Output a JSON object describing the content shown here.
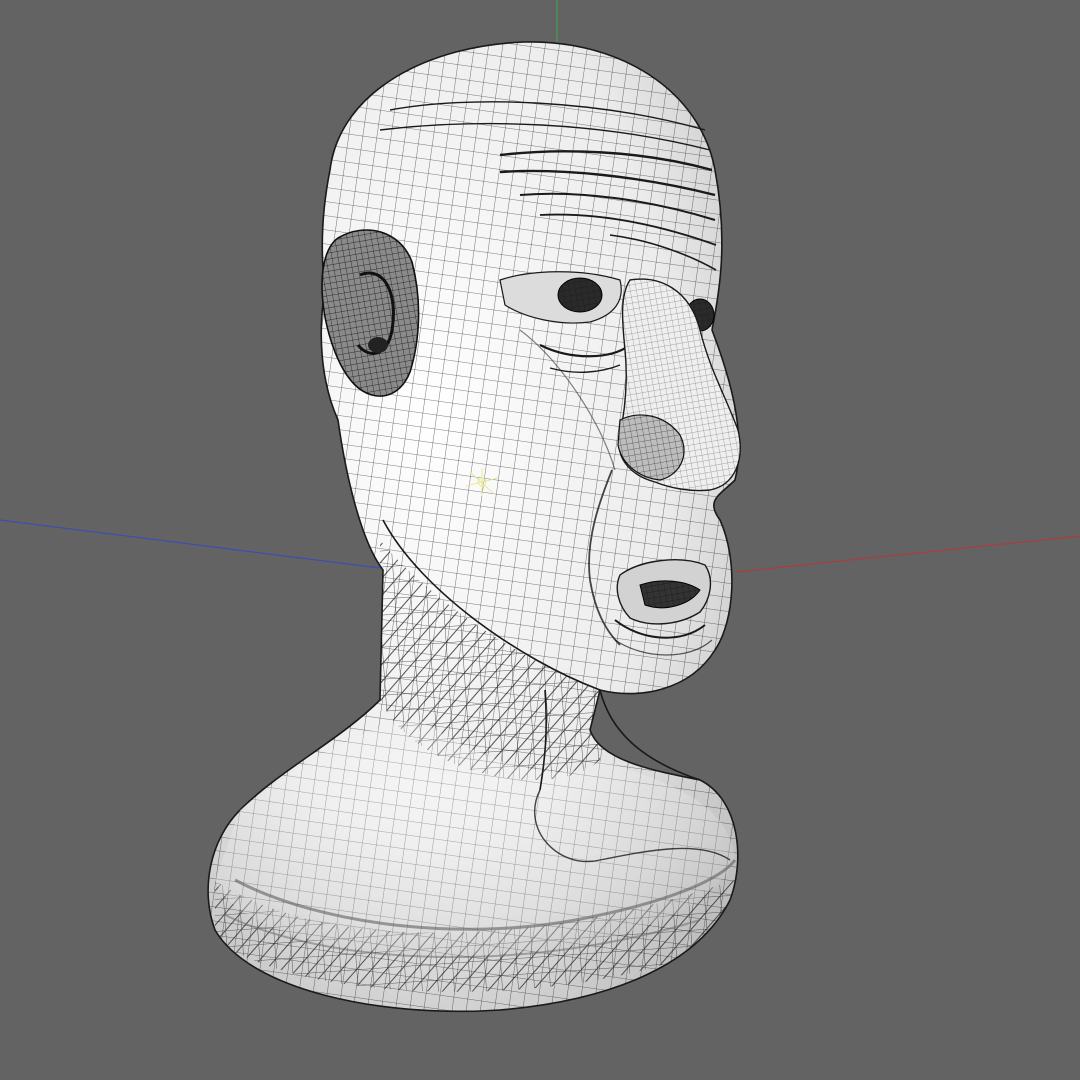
{
  "viewport": {
    "background": "#636363",
    "axes": {
      "x_axis_color": "#b03a3a",
      "y_axis_color": "#3fa34a",
      "z_axis_color": "#3a4fb0"
    },
    "model": {
      "kind": "head-bust-wireframe",
      "surface_color": "#f4f4f4",
      "shadow_color": "#c9c9c9",
      "wire_color": "#1a1a1a",
      "display_mode": "shaded-with-wireframe"
    },
    "gizmo": {
      "kind": "pivot-gizmo",
      "color": "#e8e89a"
    }
  }
}
